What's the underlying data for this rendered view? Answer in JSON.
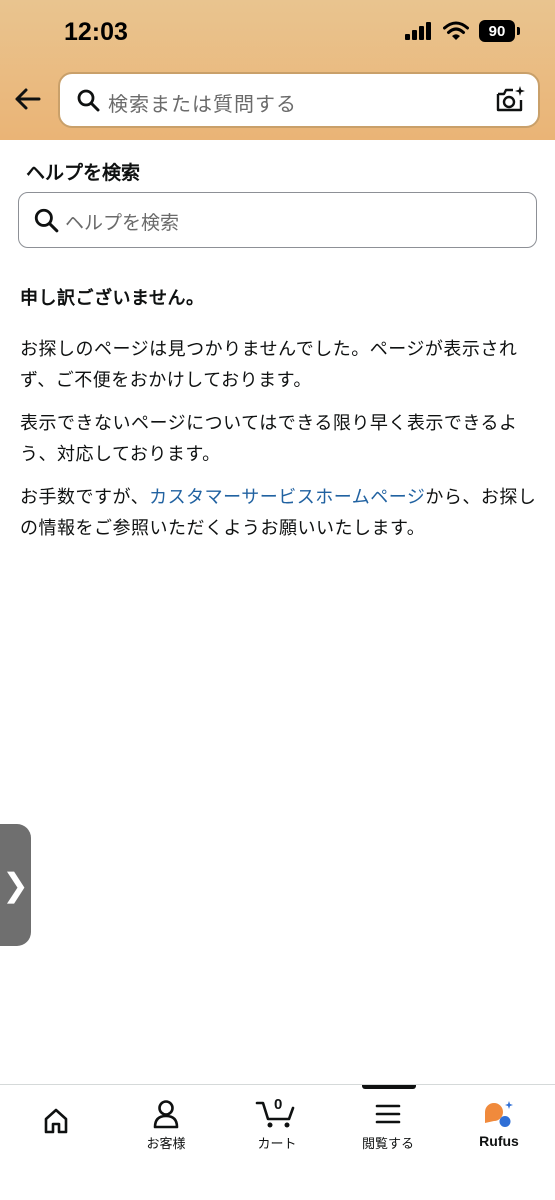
{
  "status_bar": {
    "time": "12:03",
    "battery": "90"
  },
  "header": {
    "search_placeholder": "検索または質問する"
  },
  "help": {
    "title": "ヘルプを検索",
    "search_placeholder": "ヘルプを検索"
  },
  "message": {
    "heading": "申し訳ございません。",
    "para1": "お探しのページは見つかりませんでした。ページが表示されず、ご不便をおかけしております。",
    "para2": "表示できないページについてはできる限り早く表示できるよう、対応しております。",
    "para3_before": "お手数ですが、",
    "para3_link": "カスタマーサービスホームページ",
    "para3_after": "から、お探しの情報をご参照いただくようお願いいたします。"
  },
  "side_tab": {
    "glyph": "❯"
  },
  "bottom_nav": {
    "cart_count": "0",
    "items": [
      {
        "label": "",
        "icon": "home-icon"
      },
      {
        "label": "お客様",
        "icon": "account-icon"
      },
      {
        "label": "カート",
        "icon": "cart-icon"
      },
      {
        "label": "閲覧する",
        "icon": "menu-icon"
      },
      {
        "label": "Rufus",
        "icon": "rufus-icon"
      }
    ]
  },
  "colors": {
    "header": "#eab476",
    "link": "#2162a1",
    "rufus_orange": "#f08a3c",
    "rufus_blue": "#2f6fd6"
  }
}
